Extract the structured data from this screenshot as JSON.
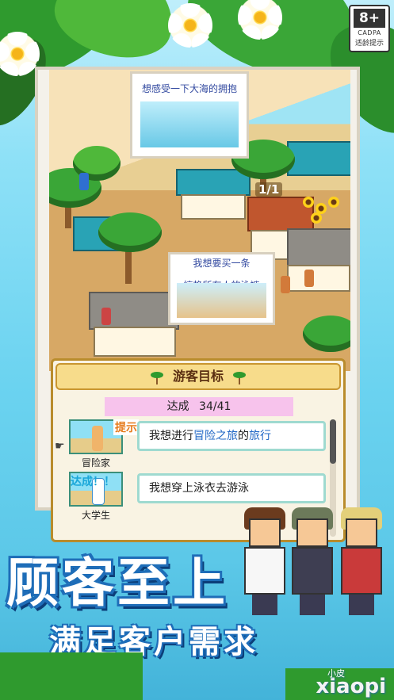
{
  "age_rating": {
    "rating": "8+",
    "org": "CADPA",
    "tip": "适龄提示"
  },
  "scene": {
    "bubble_top": "想感受一下大海的拥抱",
    "bubble_mid_line1": "我想要买一条",
    "bubble_mid_line2": "惊艳所有人的泳裤",
    "counter": "1/1"
  },
  "panel": {
    "title": "游客目标",
    "progress_label": "达成",
    "progress_value": "34/41",
    "goals": [
      {
        "tag": "提示",
        "text_before": "我想进行",
        "highlight1": "冒险之旅",
        "text_middle": "的",
        "highlight2": "旅行",
        "label": "冒险家"
      },
      {
        "tag": "达成！！",
        "text": "我想穿上泳衣去游泳",
        "label": "大学生"
      }
    ]
  },
  "headline": "顾客至上",
  "subheadline": "满足客户需求",
  "watermark": {
    "small": "小皮",
    "main": "xiaopi"
  },
  "colors": {
    "accent_blue": "#1e6db8",
    "panel_header": "#f7dc8b",
    "progress_bg": "#f7c3ec",
    "hint_orange": "#e67a1b",
    "done_blue": "#1aa7d9"
  }
}
